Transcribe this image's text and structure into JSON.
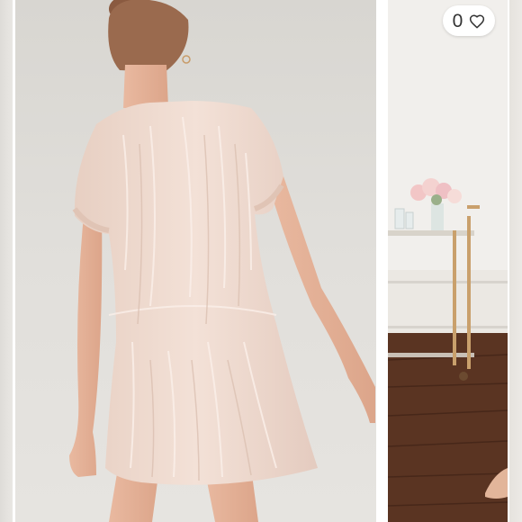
{
  "listing": {
    "photos": [
      {
        "role": "previous-photo"
      },
      {
        "role": "main-photo"
      },
      {
        "role": "next-photo"
      }
    ],
    "like_count": "0",
    "icons": {
      "like": "heart-outline-icon"
    }
  },
  "colors": {
    "dress": "#efd9cd",
    "background": "#dedcd8",
    "floor": "#5a3422",
    "pill": "#ffffff"
  }
}
